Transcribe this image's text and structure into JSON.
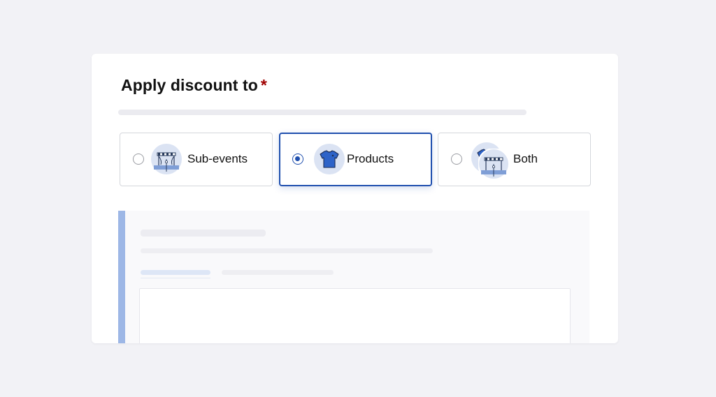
{
  "form": {
    "title": "Apply discount to",
    "required_marker": "*"
  },
  "options": [
    {
      "label": "Sub-events",
      "icon": "stage-icon",
      "selected": false
    },
    {
      "label": "Products",
      "icon": "tshirt-icon",
      "selected": true
    },
    {
      "label": "Both",
      "icon": "stage-and-tshirt-icon",
      "selected": false
    }
  ],
  "colors": {
    "accent": "#1f4fae",
    "required": "#a00000",
    "icon_bg": "#dbe3f3",
    "panel_accent": "#9db7e6"
  }
}
